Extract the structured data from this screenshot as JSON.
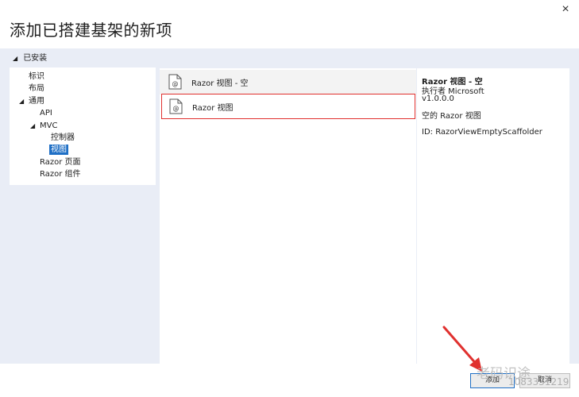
{
  "dialog": {
    "title": "添加已搭建基架的新项",
    "close_icon": "×"
  },
  "tree": {
    "header_arrow": "◢",
    "header_label": "已安装",
    "items": [
      {
        "label": "标识",
        "arrow": ""
      },
      {
        "label": "布局",
        "arrow": ""
      },
      {
        "label": "通用",
        "arrow": "◢"
      },
      {
        "label": "API",
        "arrow": ""
      },
      {
        "label": "MVC",
        "arrow": "◢"
      },
      {
        "label": "控制器",
        "arrow": ""
      },
      {
        "label": "视图",
        "arrow": "",
        "selected": true
      },
      {
        "label": "Razor 页面",
        "arrow": ""
      },
      {
        "label": "Razor 组件",
        "arrow": ""
      }
    ]
  },
  "list": {
    "items": [
      {
        "label": "Razor 视图 - 空",
        "icon": "razor-file-icon"
      },
      {
        "label": "Razor 视图",
        "icon": "razor-file-icon",
        "highlighted": true
      }
    ]
  },
  "detail": {
    "name": "Razor 视图 - 空",
    "author": "执行者 Microsoft",
    "version": "v1.0.0.0",
    "description": "空的 Razor 视图",
    "id": "ID: RazorViewEmptyScaffolder"
  },
  "footer": {
    "add_label": "添加",
    "cancel_label": "取消"
  },
  "watermark": {
    "text": "老码识途",
    "id_text": "1083331219"
  },
  "colors": {
    "selection": "#1f6fc5",
    "highlight_border": "#e0312f",
    "panel_background": "#e9edf6"
  }
}
